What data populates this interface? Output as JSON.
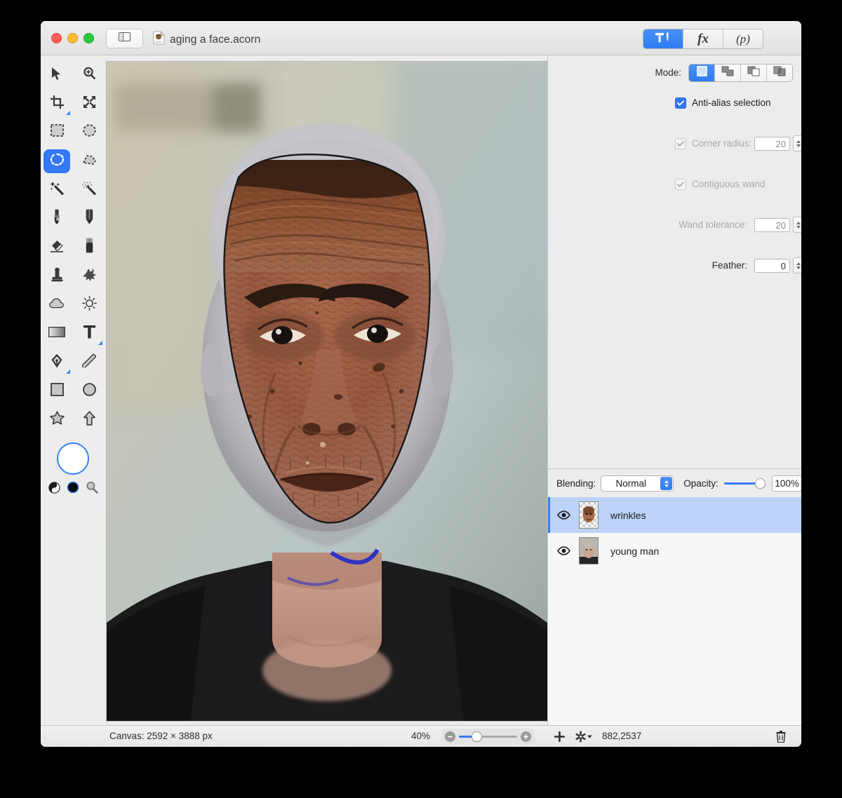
{
  "window": {
    "document_title": "aging a face.acorn",
    "doc_icon": "acorn-document-icon",
    "sidebar_toggle_icon": "sidebar-toggle-icon",
    "traffic_lights": [
      "close-button",
      "minimize-button",
      "zoom-button"
    ]
  },
  "toolbar": {
    "segments": [
      {
        "name": "tools-inspector-tab",
        "icon": "hammer-pen-icon",
        "label": "",
        "active": true
      },
      {
        "name": "filters-inspector-tab",
        "icon": "fx-icon",
        "label": "fx",
        "active": false
      },
      {
        "name": "palettes-inspector-tab",
        "icon": "p-icon",
        "label": "(p)",
        "active": false
      }
    ]
  },
  "tools": {
    "items": [
      {
        "name": "move-tool",
        "icon": "arrow-cursor-icon",
        "selected": false,
        "submenu": false
      },
      {
        "name": "zoom-tool",
        "icon": "magnifier-plus-icon",
        "selected": false,
        "submenu": false
      },
      {
        "name": "crop-tool",
        "icon": "crop-icon",
        "selected": false,
        "submenu": true
      },
      {
        "name": "transform-tool",
        "icon": "move-arrows-icon",
        "selected": false,
        "submenu": false
      },
      {
        "name": "rectangular-selection-tool",
        "icon": "dashed-rectangle-icon",
        "selected": false,
        "submenu": false
      },
      {
        "name": "elliptical-selection-tool",
        "icon": "dashed-ellipse-icon",
        "selected": false,
        "submenu": false
      },
      {
        "name": "lasso-selection-tool",
        "icon": "lasso-icon",
        "selected": true,
        "submenu": false
      },
      {
        "name": "polygon-selection-tool",
        "icon": "polygon-lasso-icon",
        "selected": false,
        "submenu": false
      },
      {
        "name": "magic-wand-tool",
        "icon": "magic-wand-icon",
        "selected": false,
        "submenu": false
      },
      {
        "name": "select-similar-tool",
        "icon": "dotted-wand-icon",
        "selected": false,
        "submenu": false
      },
      {
        "name": "paint-brush-tool",
        "icon": "paintbrush-icon",
        "selected": false,
        "submenu": false
      },
      {
        "name": "pencil-tool",
        "icon": "pencil-icon",
        "selected": false,
        "submenu": false
      },
      {
        "name": "eraser-tool",
        "icon": "eraser-icon",
        "selected": false,
        "submenu": false
      },
      {
        "name": "marker-tool",
        "icon": "marker-icon",
        "selected": false,
        "submenu": false
      },
      {
        "name": "clone-stamp-tool",
        "icon": "clone-stamp-icon",
        "selected": false,
        "submenu": false
      },
      {
        "name": "healing-brush-tool",
        "icon": "sparkle-splat-icon",
        "selected": false,
        "submenu": false
      },
      {
        "name": "blur-tool",
        "icon": "cloud-icon",
        "selected": false,
        "submenu": false
      },
      {
        "name": "dodge-tool",
        "icon": "sun-icon",
        "selected": false,
        "submenu": false
      },
      {
        "name": "gradient-tool",
        "icon": "gradient-icon",
        "selected": false,
        "submenu": false
      },
      {
        "name": "text-tool",
        "icon": "text-t-icon",
        "selected": false,
        "submenu": true
      },
      {
        "name": "bezier-pen-tool",
        "icon": "fountain-pen-icon",
        "selected": false,
        "submenu": true
      },
      {
        "name": "line-tool",
        "icon": "line-icon",
        "selected": false,
        "submenu": false
      },
      {
        "name": "rectangle-shape-tool",
        "icon": "rectangle-icon",
        "selected": false,
        "submenu": false
      },
      {
        "name": "ellipse-shape-tool",
        "icon": "ellipse-icon",
        "selected": false,
        "submenu": false
      },
      {
        "name": "star-shape-tool",
        "icon": "star-icon",
        "selected": false,
        "submenu": false
      },
      {
        "name": "arrow-shape-tool",
        "icon": "up-arrow-icon",
        "selected": false,
        "submenu": false
      }
    ],
    "color_swatch": {
      "name": "foreground-color-swatch",
      "color": "#ffffff",
      "ring": "#3a86f7"
    },
    "mini_icons": [
      {
        "name": "color-palette-icon"
      },
      {
        "name": "black-color-dot-icon"
      },
      {
        "name": "loupe-magnifier-icon"
      }
    ]
  },
  "inspector": {
    "mode_label": "Mode:",
    "mode_options": [
      {
        "name": "mode-replace",
        "icon": "replace-selection-icon",
        "active": true
      },
      {
        "name": "mode-add",
        "icon": "add-selection-icon",
        "active": false
      },
      {
        "name": "mode-subtract",
        "icon": "subtract-selection-icon",
        "active": false
      },
      {
        "name": "mode-intersect",
        "icon": "intersect-selection-icon",
        "active": false
      }
    ],
    "antialias": {
      "label": "Anti-alias selection",
      "checked": true,
      "enabled": true
    },
    "corner_radius": {
      "label": "Corner radius:",
      "checked": true,
      "enabled": false,
      "value": "20"
    },
    "contiguous_wand": {
      "label": "Contiguous wand",
      "checked": true,
      "enabled": false
    },
    "wand_tolerance": {
      "label": "Wand tolerance:",
      "enabled": false,
      "value": "20"
    },
    "feather": {
      "label": "Feather:",
      "enabled": true,
      "value": "0"
    }
  },
  "layers": {
    "blending_label": "Blending:",
    "blending_value": "Normal",
    "opacity_label": "Opacity:",
    "opacity_value": "100%",
    "opacity_percent": 100,
    "rows": [
      {
        "name": "layer-wrinkles",
        "label": "wrinkles",
        "visible": true,
        "selected": true,
        "thumb": "transparent-face-thumb"
      },
      {
        "name": "layer-young-man",
        "label": "young man",
        "visible": true,
        "selected": false,
        "thumb": "young-man-thumb"
      }
    ]
  },
  "status": {
    "canvas_label": "Canvas: 2592 × 3888 px",
    "zoom_label": "40%",
    "zoom_percent": 40,
    "add_layer_icon": "plus-icon",
    "settings_icon": "gear-dropdown-icon",
    "coordinates": "882,2537",
    "delete_icon": "trash-icon"
  },
  "colors": {
    "accent": "#3478f6",
    "selection_row": "#bcd3f7",
    "window_bg": "#ececec"
  }
}
